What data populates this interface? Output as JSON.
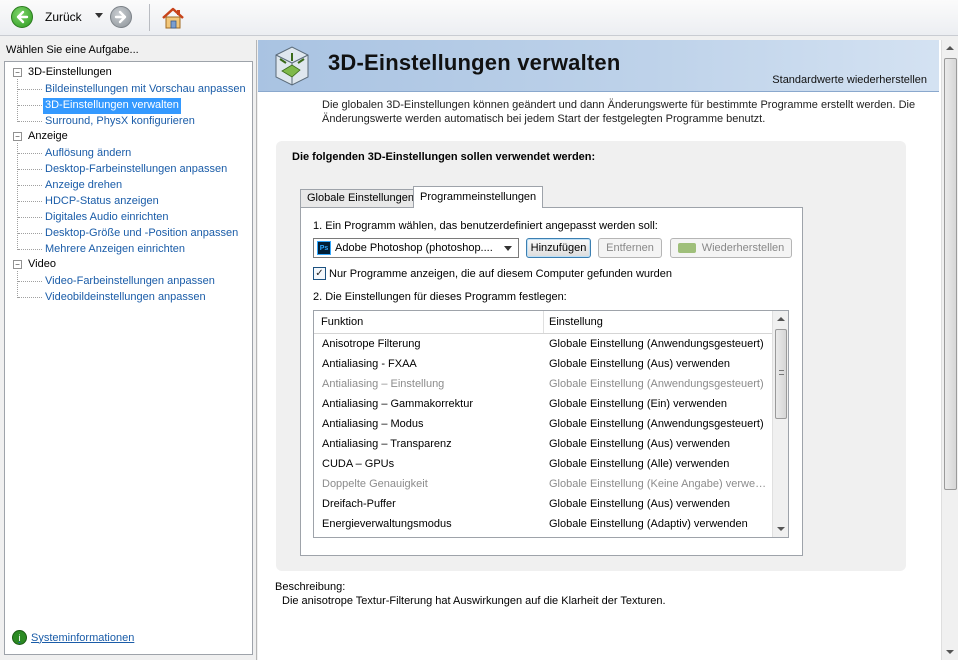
{
  "toolbar": {
    "back_label": "Zurück",
    "icons": [
      "back-arrow-icon",
      "chevron-down-icon",
      "forward-arrow-icon",
      "home-icon"
    ]
  },
  "sidebar": {
    "header": "Wählen Sie eine Aufgabe...",
    "groups": [
      {
        "label": "3D-Einstellungen",
        "items": [
          {
            "label": "Bildeinstellungen mit Vorschau anpassen"
          },
          {
            "label": "3D-Einstellungen verwalten",
            "selected": true
          },
          {
            "label": "Surround, PhysX konfigurieren"
          }
        ]
      },
      {
        "label": "Anzeige",
        "items": [
          {
            "label": "Auflösung ändern"
          },
          {
            "label": "Desktop-Farbeinstellungen anpassen"
          },
          {
            "label": "Anzeige drehen"
          },
          {
            "label": "HDCP-Status anzeigen"
          },
          {
            "label": "Digitales Audio einrichten"
          },
          {
            "label": "Desktop-Größe und -Position anpassen"
          },
          {
            "label": "Mehrere Anzeigen einrichten"
          }
        ]
      },
      {
        "label": "Video",
        "items": [
          {
            "label": "Video-Farbeinstellungen anpassen"
          },
          {
            "label": "Videobildeinstellungen anpassen"
          }
        ]
      }
    ],
    "system_info": "Systeminformationen"
  },
  "main": {
    "title": "3D-Einstellungen verwalten",
    "restore_defaults": "Standardwerte wiederherstellen",
    "intro": "Die globalen 3D-Einstellungen können geändert und dann Änderungswerte für bestimmte Programme erstellt werden. Die Änderungswerte werden automatisch bei jedem Start der festgelegten Programme benutzt.",
    "panel_heading": "Die folgenden 3D-Einstellungen sollen verwendet werden:",
    "tabs": [
      {
        "label": "Globale Einstellungen",
        "active": false
      },
      {
        "label": "Programmeinstellungen",
        "active": true
      }
    ],
    "step1_label": "1. Ein Programm wählen, das benutzerdefiniert angepasst werden soll:",
    "program_select": {
      "value": "Adobe Photoshop (photoshop....",
      "icon_text": "Ps"
    },
    "buttons": {
      "add": "Hinzufügen",
      "remove": "Entfernen",
      "restore": "Wiederherstellen"
    },
    "checkbox": {
      "label": "Nur Programme anzeigen, die auf diesem Computer gefunden wurden",
      "checked": true,
      "mark": "✓"
    },
    "step2_label": "2. Die Einstellungen für dieses Programm festlegen:",
    "table": {
      "headers": [
        "Funktion",
        "Einstellung"
      ],
      "rows": [
        {
          "func": "Anisotrope Filterung",
          "setting": "Globale Einstellung (Anwendungsgesteuert)",
          "disabled": false
        },
        {
          "func": "Antialiasing - FXAA",
          "setting": "Globale Einstellung (Aus) verwenden",
          "disabled": false
        },
        {
          "func": "Antialiasing – Einstellung",
          "setting": "Globale Einstellung (Anwendungsgesteuert)",
          "disabled": true
        },
        {
          "func": "Antialiasing – Gammakorrektur",
          "setting": "Globale Einstellung (Ein) verwenden",
          "disabled": false
        },
        {
          "func": "Antialiasing – Modus",
          "setting": "Globale Einstellung (Anwendungsgesteuert)",
          "disabled": false
        },
        {
          "func": "Antialiasing – Transparenz",
          "setting": "Globale Einstellung (Aus) verwenden",
          "disabled": false
        },
        {
          "func": "CUDA – GPUs",
          "setting": "Globale Einstellung (Alle) verwenden",
          "disabled": false
        },
        {
          "func": "Doppelte Genauigkeit",
          "setting": "Globale Einstellung (Keine Angabe) verwenden",
          "disabled": true
        },
        {
          "func": "Dreifach-Puffer",
          "setting": "Globale Einstellung (Aus) verwenden",
          "disabled": false
        },
        {
          "func": "Energieverwaltungsmodus",
          "setting": "Globale Einstellung (Adaptiv) verwenden",
          "disabled": false
        }
      ]
    },
    "description_label": "Beschreibung:",
    "description_text": "Die anisotrope Textur-Filterung hat Auswirkungen auf die Klarheit der Texturen."
  },
  "colors": {
    "link": "#1a5ca8",
    "selection": "#3399ff",
    "banner": "#bfd3ea"
  }
}
